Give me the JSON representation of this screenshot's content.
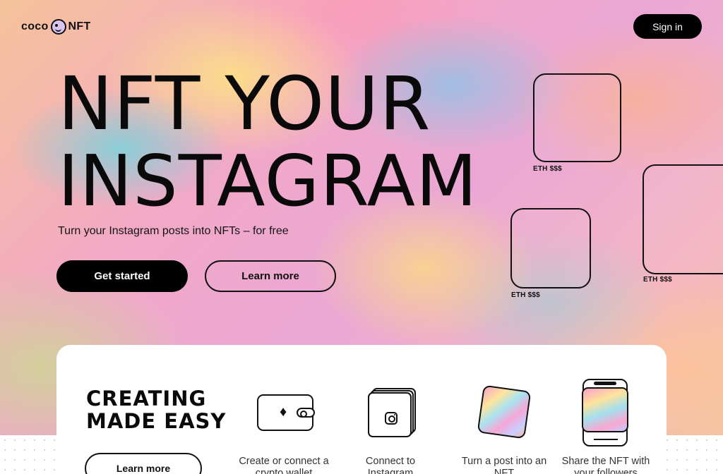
{
  "header": {
    "logo_left": "coco",
    "logo_right": "NFT",
    "signin_label": "Sign in"
  },
  "hero": {
    "title_line1": "NFT YOUR",
    "title_line2": "INSTAGRAM",
    "subtitle": "Turn your Instagram posts into NFTs – for free",
    "primary_label": "Get started",
    "secondary_label": "Learn more"
  },
  "cards": [
    {
      "price": "ETH $$$"
    },
    {
      "price": "ETH $$$"
    },
    {
      "price": "ETH $$$"
    }
  ],
  "features": {
    "title_line1": "CREATING",
    "title_line2": "MADE EASY",
    "learn_more_label": "Learn more",
    "items": [
      {
        "label": "Create or connect a crypto wallet",
        "icon": "wallet-icon"
      },
      {
        "label": "Connect to Instagram",
        "icon": "instagram-icon"
      },
      {
        "label": "Turn a post into an NFT",
        "icon": "nft-card-icon"
      },
      {
        "label": "Share the NFT with your followers",
        "icon": "phone-icon"
      }
    ]
  },
  "colors": {
    "primary": "#000000",
    "panel": "#ffffff",
    "background_accents": [
      "#f2a9c6",
      "#ffe59a",
      "#a9e3f0",
      "#f6c39a"
    ]
  }
}
